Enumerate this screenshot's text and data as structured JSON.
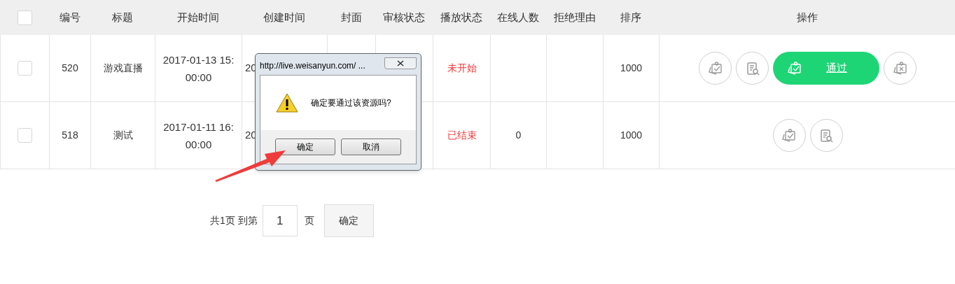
{
  "table": {
    "columns": [
      "编号",
      "标题",
      "开始时间",
      "创建时间",
      "封面",
      "审核状态",
      "播放状态",
      "在线人数",
      "拒绝理由",
      "排序",
      "操作"
    ],
    "header_checked": false,
    "rows": [
      {
        "checked": false,
        "id": "520",
        "title": "游戏直播",
        "start": "2017-01-13 15:\n00:00",
        "created": "20",
        "play_status": "未开始",
        "online": "",
        "sort": "1000",
        "actions": [
          {
            "kind": "approve"
          },
          {
            "kind": "view"
          },
          {
            "kind": "approve-label",
            "label": "通过"
          },
          {
            "kind": "reject"
          }
        ]
      },
      {
        "checked": false,
        "id": "518",
        "title": "测试",
        "start": "2017-01-11 16:\n00:00",
        "created": "20",
        "play_status": "已结束",
        "online": "0",
        "sort": "1000",
        "actions": [
          {
            "kind": "approve"
          },
          {
            "kind": "view"
          }
        ]
      }
    ]
  },
  "pagination": {
    "summary": "共1页 到第",
    "page": "1",
    "unit": "页",
    "button": "确定"
  },
  "dialog": {
    "title": "http://live.weisanyun.com/ ...",
    "message": "确定要通过该资源吗?",
    "buttons": [
      "确定",
      "取消"
    ]
  }
}
